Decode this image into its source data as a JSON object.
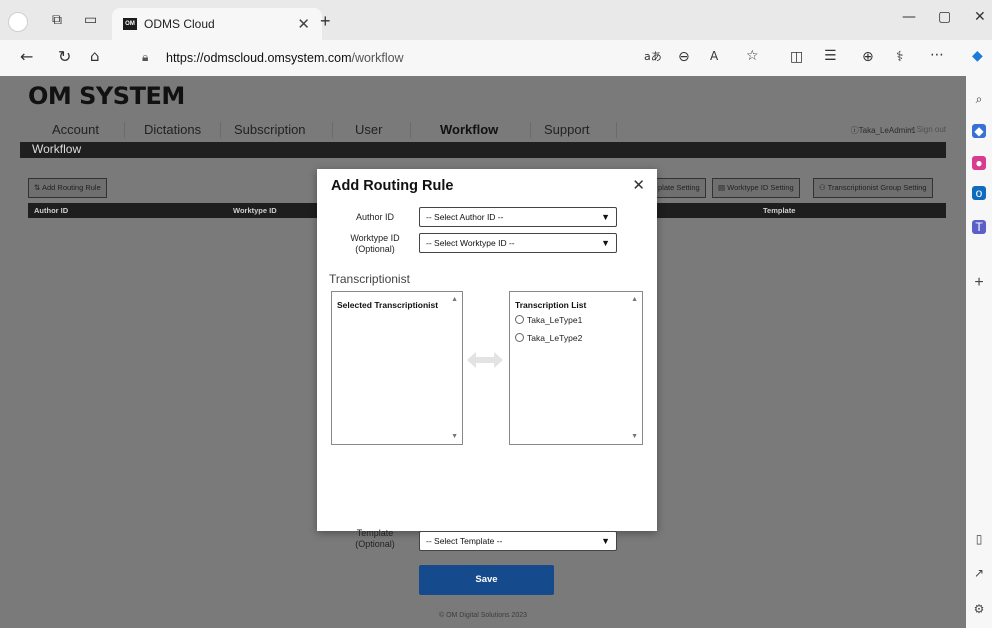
{
  "browser": {
    "tab_title": "ODMS Cloud",
    "tab_favicon_text": "OM",
    "url_host": "https://odmscloud.omsystem.com",
    "url_path": "/workflow"
  },
  "app": {
    "logo": "OM SYSTEM",
    "nav": [
      "Account",
      "Dictations",
      "Subscription",
      "User",
      "Workflow",
      "Support"
    ],
    "active_nav": "Workflow",
    "user_label": "Taka_LeAdmin1",
    "signout_label": "Sign out",
    "page_title": "Workflow",
    "toolbar": {
      "add_routing_rule": "Add Routing Rule",
      "template_setting": "plate Setting",
      "worktype_id_setting": "Worktype ID Setting",
      "transcriptionist_group_setting": "Transcriptionist Group Setting"
    },
    "table_headers": [
      "Author ID",
      "Worktype ID",
      "Template"
    ],
    "footer": "© OM Digital Solutions 2023"
  },
  "modal": {
    "title": "Add Routing Rule",
    "author_label": "Author ID",
    "author_placeholder": "-- Select Author ID --",
    "worktype_label": "Worktype ID",
    "worktype_optional": "(Optional)",
    "worktype_placeholder": "-- Select Worktype ID --",
    "section_title": "Transcriptionist",
    "selected_header": "Selected Transcriptionist",
    "list_header": "Transcription List",
    "list_items": [
      "Taka_LeType1",
      "Taka_LeType2"
    ],
    "template_label": "Template",
    "template_optional": "(Optional)",
    "template_placeholder": "-- Select Template --",
    "save_label": "Save"
  },
  "colors": {
    "overlay": "#7a7a7a",
    "primary_button": "#154a8c",
    "header_bar": "#1f1f1f"
  }
}
